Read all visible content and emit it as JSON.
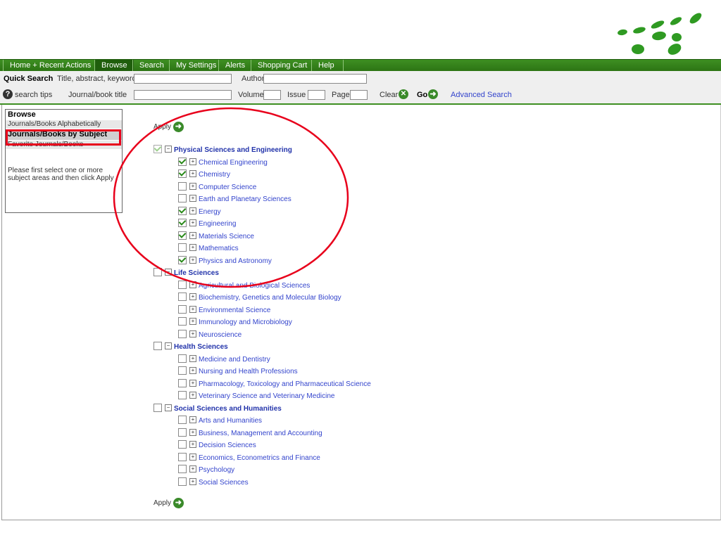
{
  "nav": {
    "tabs": [
      {
        "label": "Home + Recent Actions"
      },
      {
        "label": "Browse"
      },
      {
        "label": "Search"
      },
      {
        "label": "My Settings"
      },
      {
        "label": "Alerts"
      },
      {
        "label": "Shopping Cart"
      },
      {
        "label": "Help"
      }
    ],
    "active": "Browse"
  },
  "quick_search": {
    "title": "Quick Search",
    "title_abstract_label": "Title, abstract, keywords",
    "title_abstract_value": "",
    "author_label": "Author",
    "author_value": "",
    "search_tips": "search tips",
    "journal_label": "Journal/book title",
    "journal_value": "",
    "volume_label": "Volume",
    "volume_value": "",
    "issue_label": "Issue",
    "issue_value": "",
    "page_label": "Page",
    "page_value": "",
    "clear_label": "Clear",
    "go_label": "Go",
    "advanced_search": "Advanced Search"
  },
  "browse": {
    "title": "Browse",
    "items": [
      {
        "label": "Journals/Books Alphabetically"
      },
      {
        "label": "Journals/Books by Subject"
      },
      {
        "label": "Favorite Journals/Books"
      }
    ],
    "note": "Please first select one or more subject areas and then click Apply"
  },
  "apply_label": "Apply",
  "tree": [
    {
      "label": "Physical Sciences and Engineering",
      "checked": true,
      "children": [
        {
          "label": "Chemical Engineering",
          "checked": true
        },
        {
          "label": "Chemistry",
          "checked": true
        },
        {
          "label": "Computer Science",
          "checked": false
        },
        {
          "label": "Earth and Planetary Sciences",
          "checked": false
        },
        {
          "label": "Energy",
          "checked": true
        },
        {
          "label": "Engineering",
          "checked": true
        },
        {
          "label": "Materials Science",
          "checked": true
        },
        {
          "label": "Mathematics",
          "checked": false
        },
        {
          "label": "Physics and Astronomy",
          "checked": true
        }
      ]
    },
    {
      "label": "Life Sciences",
      "checked": false,
      "children": [
        {
          "label": "Agricultural and Biological Sciences",
          "checked": false
        },
        {
          "label": "Biochemistry, Genetics and Molecular Biology",
          "checked": false
        },
        {
          "label": "Environmental Science",
          "checked": false
        },
        {
          "label": "Immunology and Microbiology",
          "checked": false
        },
        {
          "label": "Neuroscience",
          "checked": false
        }
      ]
    },
    {
      "label": "Health Sciences",
      "checked": false,
      "children": [
        {
          "label": "Medicine and Dentistry",
          "checked": false
        },
        {
          "label": "Nursing and Health Professions",
          "checked": false
        },
        {
          "label": "Pharmacology, Toxicology and Pharmaceutical Science",
          "checked": false
        },
        {
          "label": "Veterinary Science and Veterinary Medicine",
          "checked": false
        }
      ]
    },
    {
      "label": "Social Sciences and Humanities",
      "checked": false,
      "children": [
        {
          "label": "Arts and Humanities",
          "checked": false
        },
        {
          "label": "Business, Management and Accounting",
          "checked": false
        },
        {
          "label": "Decision Sciences",
          "checked": false
        },
        {
          "label": "Economics, Econometrics and Finance",
          "checked": false
        },
        {
          "label": "Psychology",
          "checked": false
        },
        {
          "label": "Social Sciences",
          "checked": false
        }
      ]
    }
  ],
  "colors": {
    "nav_green": "#3e8f22",
    "highlight_red": "#e8001b",
    "logo_green": "#2f9a22",
    "link_blue": "#3344cc"
  }
}
